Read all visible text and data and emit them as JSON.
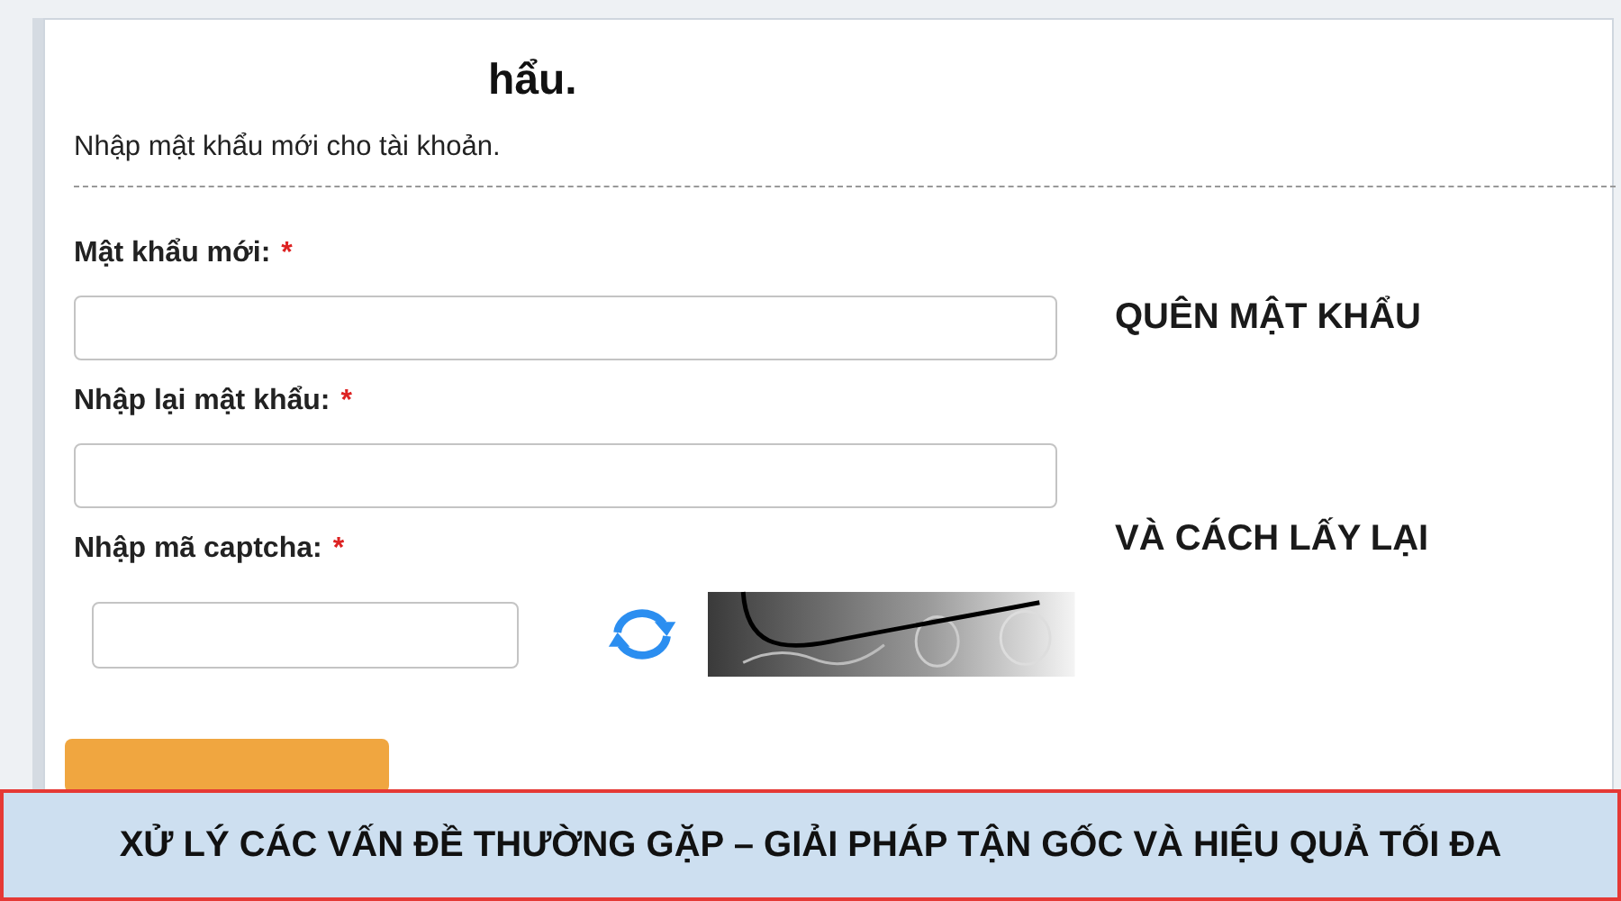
{
  "form": {
    "title": "hẩu.",
    "subtitle": "Nhập mật khẩu mới cho tài khoản.",
    "fields": [
      {
        "label": "Mật khẩu mới:",
        "required_mark": "*",
        "kind": "text"
      },
      {
        "label": "Nhập lại mật khẩu:",
        "required_mark": "*",
        "kind": "text"
      },
      {
        "label": "Nhập mã captcha:",
        "required_mark": "*",
        "kind": "captcha"
      }
    ]
  },
  "side_text": [
    "QUÊN MẬT KHẨU",
    "VÀ CÁCH LẤY LẠI"
  ],
  "banner": "XỬ LÝ CÁC VẤN ĐỀ THƯỜNG GẶP – GIẢI PHÁP TẬN GỐC VÀ HIỆU QUẢ TỐI ĐA"
}
